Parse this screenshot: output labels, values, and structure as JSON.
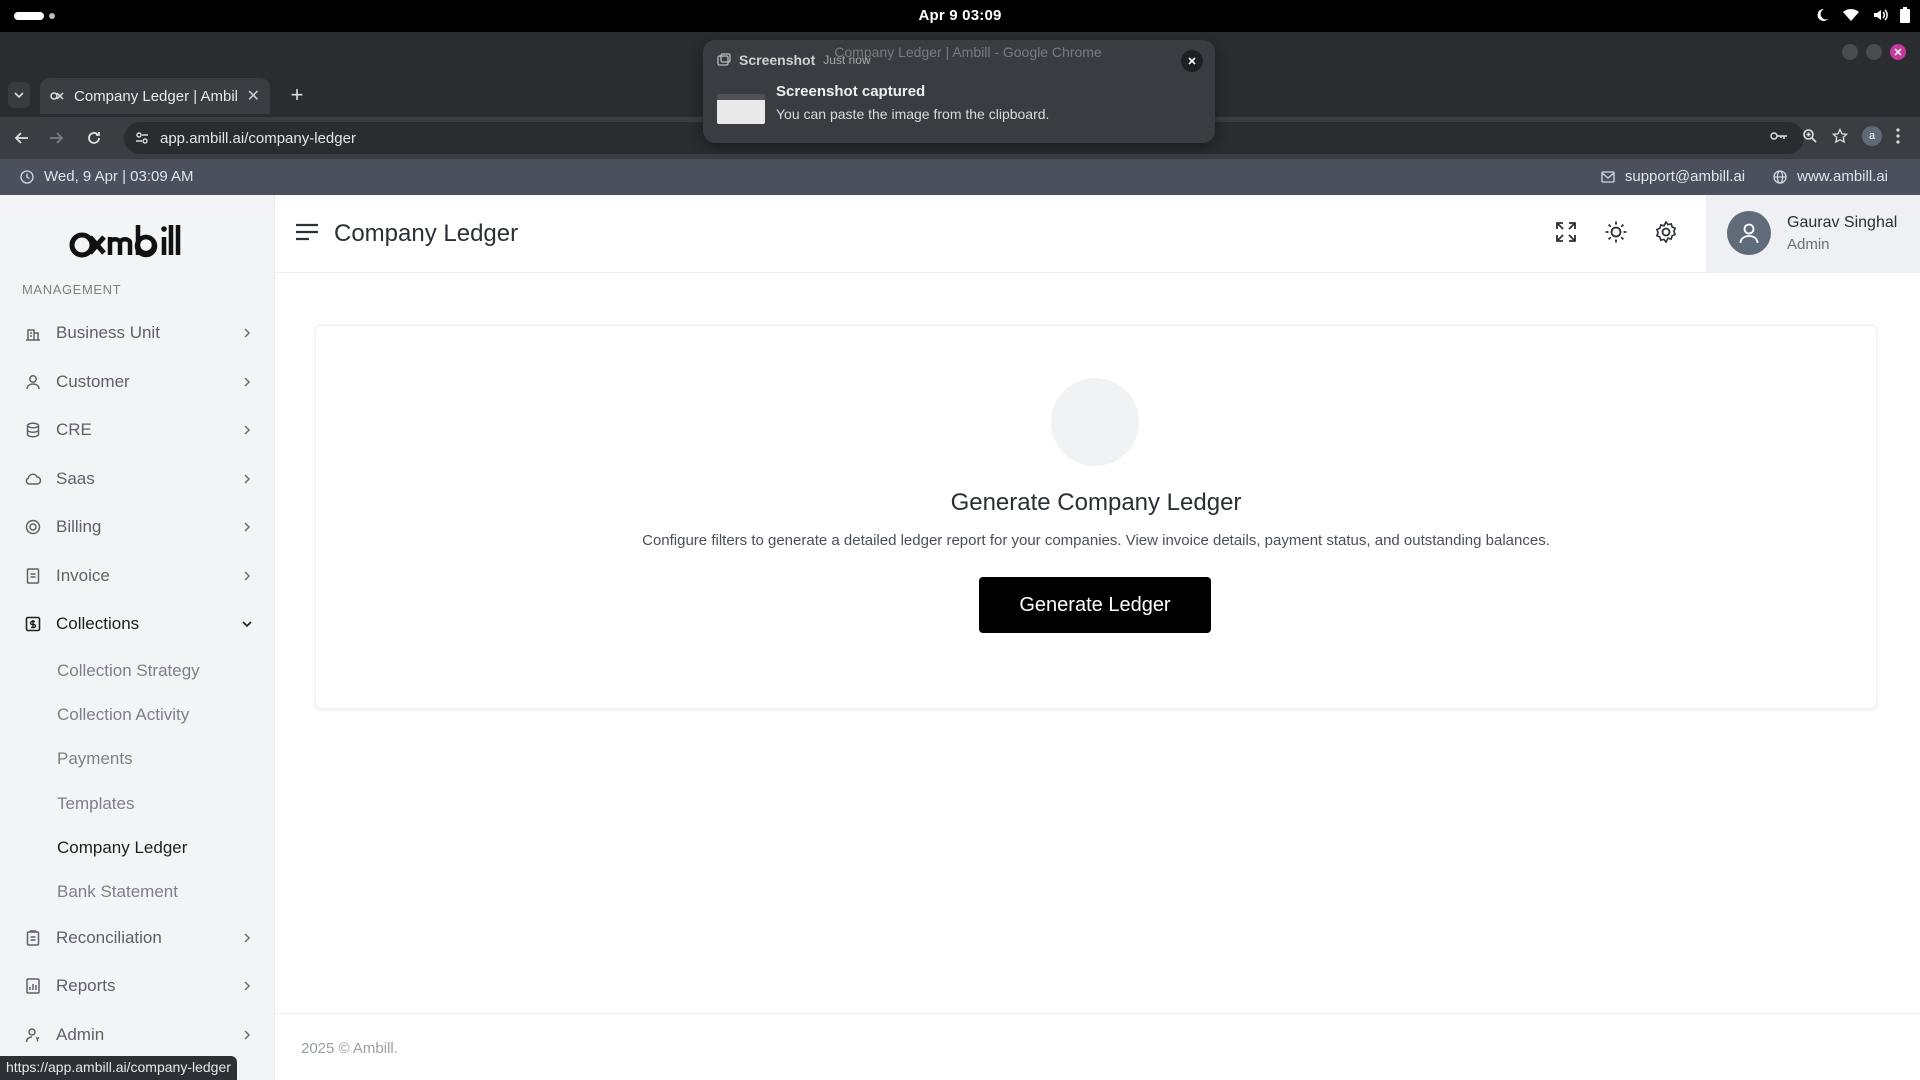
{
  "os": {
    "clock": "Apr 9  03:09"
  },
  "browser": {
    "tab_title": "Company Ledger | Ambill",
    "url": "app.ambill.ai/company-ledger",
    "profile_initial": "a",
    "window_title": "Company Ledger | Ambill - Google Chrome",
    "status_url": "https://app.ambill.ai/company-ledger"
  },
  "notification": {
    "app": "Screenshot",
    "time": "Just now",
    "title": "Screenshot captured",
    "body": "You can paste the image from the clipboard."
  },
  "info_bar": {
    "datetime": "Wed, 9 Apr | 03:09 AM",
    "email": "support@ambill.ai",
    "website": "www.ambill.ai"
  },
  "sidebar": {
    "logo": "ambill",
    "section": "MANAGEMENT",
    "items": [
      {
        "label": "Business Unit",
        "icon": "building-icon"
      },
      {
        "label": "Customer",
        "icon": "user-icon"
      },
      {
        "label": "CRE",
        "icon": "database-icon"
      },
      {
        "label": "Saas",
        "icon": "cloud-icon"
      },
      {
        "label": "Billing",
        "icon": "billing-icon"
      },
      {
        "label": "Invoice",
        "icon": "document-icon"
      },
      {
        "label": "Collections",
        "icon": "dollar-icon"
      },
      {
        "label": "Reconciliation",
        "icon": "clipboard-icon"
      },
      {
        "label": "Reports",
        "icon": "chart-icon"
      },
      {
        "label": "Admin",
        "icon": "user-gear-icon"
      }
    ],
    "collections_sub": [
      "Collection Strategy",
      "Collection Activity",
      "Payments",
      "Templates",
      "Company Ledger",
      "Bank Statement"
    ]
  },
  "header": {
    "title": "Company Ledger",
    "user_name": "Gaurav Singhal",
    "user_role": "Admin"
  },
  "main": {
    "card_title": "Generate Company Ledger",
    "card_description": "Configure filters to generate a detailed ledger report for your companies. View invoice details, payment status, and outstanding balances.",
    "button_label": "Generate Ledger"
  },
  "footer": {
    "text": "2025 © Ambill."
  },
  "colors": {
    "info_bar": "#4b515c",
    "sidebar_bg": "#f3f4f6",
    "primary_button": "#000000",
    "chrome_bg": "#2b2c30"
  }
}
